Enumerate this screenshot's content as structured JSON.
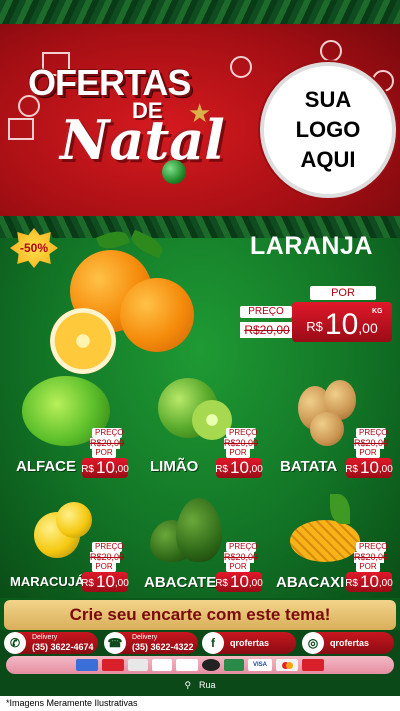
{
  "header": {
    "title_line1": "OFERTAS",
    "title_line2": "DE",
    "title_line3": "Natal",
    "logo_line1": "SUA",
    "logo_line2": "LOGO",
    "logo_line3": "AQUI"
  },
  "hero": {
    "discount_badge": "-50%",
    "name": "LARANJA",
    "preco_label": "PREÇO",
    "old_price": "R$20,00",
    "por_label": "POR",
    "currency": "R$",
    "price_int": "10",
    "price_dec": ",00",
    "unit": "KG"
  },
  "products": [
    {
      "name": "ALFACE",
      "preco_label": "PREÇO",
      "old_price": "R$20,00",
      "por_label": "POR",
      "currency": "R$",
      "price_int": "10",
      "price_dec": ",00"
    },
    {
      "name": "LIMÃO",
      "preco_label": "PREÇO",
      "old_price": "R$20,00",
      "por_label": "POR",
      "currency": "R$",
      "price_int": "10",
      "price_dec": ",00"
    },
    {
      "name": "BATATA",
      "preco_label": "PREÇO",
      "old_price": "R$20,00",
      "por_label": "POR",
      "currency": "R$",
      "price_int": "10",
      "price_dec": ",00"
    },
    {
      "name": "MARACUJÁ",
      "preco_label": "PREÇO",
      "old_price": "R$20,00",
      "por_label": "POR",
      "currency": "R$",
      "price_int": "10",
      "price_dec": ",00"
    },
    {
      "name": "ABACATE",
      "preco_label": "PREÇO",
      "old_price": "R$20,00",
      "por_label": "POR",
      "currency": "R$",
      "price_int": "10",
      "price_dec": ",00"
    },
    {
      "name": "ABACAXI",
      "preco_label": "PREÇO",
      "old_price": "R$20,00",
      "por_label": "POR",
      "currency": "R$",
      "price_int": "10",
      "price_dec": ",00"
    }
  ],
  "cta": "Crie seu encarte com este tema!",
  "contacts": [
    {
      "icon": "whatsapp-icon",
      "label": "Delivery",
      "value": "(35) 3622-4674"
    },
    {
      "icon": "phone-icon",
      "label": "Delivery",
      "value": "(35) 3622-4322"
    },
    {
      "icon": "facebook-icon",
      "label": "",
      "value": "qrofertas"
    },
    {
      "icon": "instagram-icon",
      "label": "",
      "value": "qrofertas"
    }
  ],
  "payments": [
    "VISA"
  ],
  "address": "Rua",
  "footer_note": "*Imagens Meramente Ilustrativas",
  "colors": {
    "red": "#c8161f",
    "green": "#127526",
    "gold": "#d9ae5a"
  }
}
